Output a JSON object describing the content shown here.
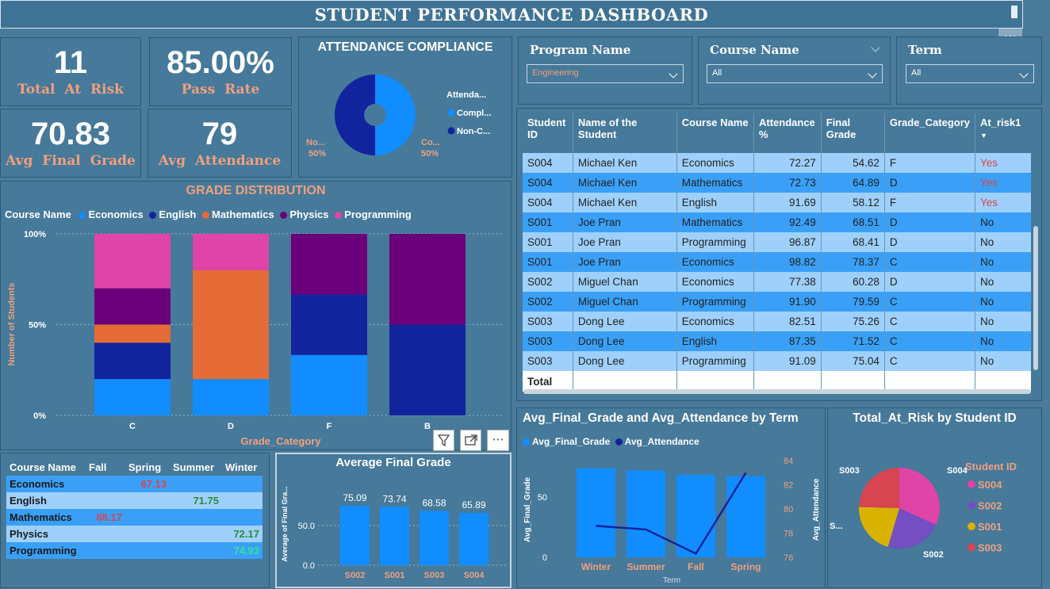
{
  "header": {
    "title": "STUDENT PERFORMANCE DASHBOARD"
  },
  "kpis": [
    {
      "value": "11",
      "label": "Total At Risk"
    },
    {
      "value": "85.00%",
      "label": "Pass Rate"
    },
    {
      "value": "70.83",
      "label": "Avg Final Grade"
    },
    {
      "value": "79",
      "label": "Avg Attendance"
    }
  ],
  "attendance": {
    "title": "ATTENDANCE COMPLIANCE",
    "legend_title": "Attenda...",
    "legend": [
      {
        "label": "Compl...",
        "color": "#118dff"
      },
      {
        "label": "Non-C...",
        "color": "#12239e"
      }
    ],
    "left_label": "No...",
    "left_pct": "50%",
    "right_label": "Co...",
    "right_pct": "50%"
  },
  "slicers": [
    {
      "title": "Program Name",
      "value": "Engineering",
      "color": "#f0a07e"
    },
    {
      "title": "Course Name",
      "value": "All",
      "color": "#ffffff"
    },
    {
      "title": "Term",
      "value": "All",
      "color": "#ffffff"
    }
  ],
  "table": {
    "headers": [
      "Student ID",
      "Name of the Student",
      "Course Name",
      "Attendance %",
      "Final Grade",
      "Grade_Category",
      "At_risk1"
    ],
    "rows": [
      [
        "S004",
        "Michael Ken",
        "Economics",
        "72.27",
        "54.62",
        "F",
        "Yes"
      ],
      [
        "S004",
        "Michael Ken",
        "Mathematics",
        "72.73",
        "64.89",
        "D",
        "Yes"
      ],
      [
        "S004",
        "Michael Ken",
        "English",
        "91.69",
        "58.12",
        "F",
        "Yes"
      ],
      [
        "S001",
        "Joe Pran",
        "Mathematics",
        "92.49",
        "68.51",
        "D",
        "No"
      ],
      [
        "S001",
        "Joe Pran",
        "Programming",
        "96.87",
        "68.41",
        "D",
        "No"
      ],
      [
        "S001",
        "Joe Pran",
        "Economics",
        "98.82",
        "78.37",
        "C",
        "No"
      ],
      [
        "S002",
        "Miguel Chan",
        "Economics",
        "77.38",
        "60.28",
        "D",
        "No"
      ],
      [
        "S002",
        "Miguel Chan",
        "Programming",
        "91.90",
        "79.59",
        "C",
        "No"
      ],
      [
        "S003",
        "Dong Lee",
        "Economics",
        "82.51",
        "75.26",
        "C",
        "No"
      ],
      [
        "S003",
        "Dong Lee",
        "English",
        "87.35",
        "71.52",
        "C",
        "No"
      ],
      [
        "S003",
        "Dong Lee",
        "Programming",
        "91.09",
        "75.04",
        "C",
        "No"
      ]
    ],
    "total_label": "Total"
  },
  "grade_dist": {
    "title": "GRADE DISTRIBUTION",
    "legend_title": "Course Name",
    "ylabel": "Number of Students",
    "xlabel": "Grade_Category"
  },
  "matrix": {
    "headers": [
      "Course Name",
      "Fall",
      "Spring",
      "Summer",
      "Winter"
    ],
    "rows": [
      {
        "name": "Economics",
        "fall": "",
        "spring": "67.13",
        "summer": "",
        "winter": ""
      },
      {
        "name": "English",
        "fall": "",
        "spring": "",
        "summer": "71.75",
        "winter": ""
      },
      {
        "name": "Mathematics",
        "fall": "68.17",
        "spring": "",
        "summer": "",
        "winter": ""
      },
      {
        "name": "Physics",
        "fall": "",
        "spring": "",
        "summer": "",
        "winter": "72.17"
      },
      {
        "name": "Programming",
        "fall": "",
        "spring": "",
        "summer": "",
        "winter": "74.93"
      }
    ]
  },
  "chart_data": [
    {
      "type": "bar",
      "stacked": true,
      "percent": true,
      "title": "GRADE DISTRIBUTION",
      "xlabel": "Grade_Category",
      "ylabel": "Number of Students",
      "categories": [
        "C",
        "D",
        "F",
        "B"
      ],
      "yticks": [
        "0%",
        "50%",
        "100%"
      ],
      "series": [
        {
          "name": "Economics",
          "color": "#118dff",
          "values": [
            20,
            20,
            33.3,
            0
          ]
        },
        {
          "name": "English",
          "color": "#12239e",
          "values": [
            20,
            0,
            33.3,
            50
          ]
        },
        {
          "name": "Mathematics",
          "color": "#e66c37",
          "values": [
            10,
            60,
            0,
            0
          ]
        },
        {
          "name": "Physics",
          "color": "#6b007b",
          "values": [
            20,
            0,
            33.4,
            50
          ]
        },
        {
          "name": "Programming",
          "color": "#e044a7",
          "values": [
            30,
            20,
            0,
            0
          ]
        }
      ],
      "legend": "top"
    },
    {
      "type": "bar",
      "title": "Average Final Grade",
      "ylabel": "Average of Final Gra...",
      "categories": [
        "S002",
        "S001",
        "S003",
        "S004"
      ],
      "values": [
        75.09,
        73.74,
        68.58,
        65.89
      ],
      "yticks": [
        "0.0",
        "50.0"
      ],
      "ylim": [
        0,
        100
      ]
    },
    {
      "type": "bar+line",
      "title": "Avg_Final_Grade and Avg_Attendance by Term",
      "xlabel": "Term",
      "ylabel": "Avg_Final_Grade",
      "y2label": "Avg_Attendance",
      "categories": [
        "Winter",
        "Summer",
        "Fall",
        "Spring"
      ],
      "series": [
        {
          "name": "Avg_Final_Grade",
          "color": "#118dff",
          "values": [
            73.55,
            71.75,
            68.17,
            67.13
          ]
        },
        {
          "name": "Avg_Attendance",
          "color": "#12239e",
          "values": [
            78.6,
            78.3,
            76.3,
            83.0
          ]
        }
      ],
      "yticks": [
        "0",
        "50"
      ],
      "y2ticks": [
        "76",
        "78",
        "80",
        "82",
        "84"
      ],
      "ylim": [
        0,
        80
      ],
      "y2lim": [
        76,
        84
      ]
    },
    {
      "type": "pie",
      "title": "Total_At_Risk by Student ID",
      "legend_title": "Student ID",
      "categories": [
        "S004",
        "S002",
        "S001",
        "S003"
      ],
      "values": [
        3.5,
        2.5,
        2.3,
        2.7
      ],
      "colors": [
        "#e044a7",
        "#744ec2",
        "#d9b300",
        "#d64550"
      ],
      "labels": [
        "S004",
        "S002",
        "S...",
        "S003"
      ]
    }
  ]
}
